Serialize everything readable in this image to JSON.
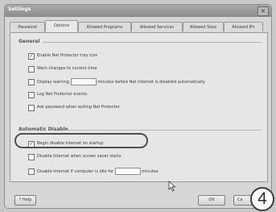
{
  "window": {
    "title": "Settings",
    "close_glyph": "×"
  },
  "tabs": [
    {
      "label": "Password",
      "active": false
    },
    {
      "label": "Options",
      "active": true
    },
    {
      "label": "Allowed Programs",
      "active": false
    },
    {
      "label": "Allowed Services",
      "active": false
    },
    {
      "label": "Allowed Sites",
      "active": false
    },
    {
      "label": "Allowed IPs",
      "active": false
    }
  ],
  "general": {
    "heading": "General",
    "options": [
      {
        "label": "Enable Net Protector tray icon",
        "checked": true
      },
      {
        "label": "Warn changes to current time",
        "checked": false
      },
      {
        "label": "Display warning",
        "suffix": "minutes before Net Internet is disabled automatically",
        "checked": false
      },
      {
        "label": "Log Net Protector events",
        "checked": false
      },
      {
        "label": "Ask password when exiting Net Protector",
        "checked": false
      }
    ]
  },
  "automatic_disable": {
    "heading": "Automatic Disable",
    "options": [
      {
        "label": "Begin disable Internet on startup",
        "checked": true
      },
      {
        "label": "Disable Internet when screen saver starts",
        "checked": false
      },
      {
        "label": "Disable Internet if computer is idle for",
        "suffix": "minutes",
        "checked": false
      }
    ]
  },
  "footer": {
    "help_label": "Help",
    "ok_label": "OK",
    "cancel_label": "Ca"
  },
  "step_number": "4",
  "icons": {
    "cursor": "mouse-pointer-icon",
    "check": "✓"
  }
}
